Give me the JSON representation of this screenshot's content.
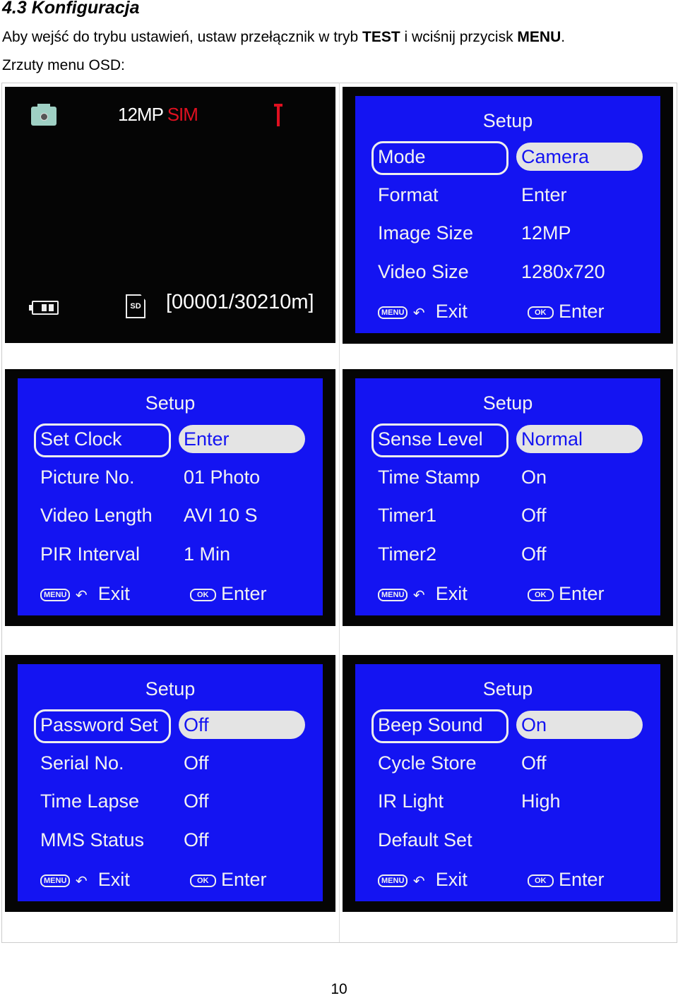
{
  "heading": "4.3 Konfiguracja",
  "intro": {
    "pre": "Aby wejść do trybu ustawień, ustaw przełącznik w tryb ",
    "b1": "TEST",
    "mid": " i wciśnij przycisk ",
    "b2": "MENU",
    "post": "."
  },
  "caption": "Zrzuty menu OSD:",
  "live_view": {
    "resolution": "12MP",
    "sim": "SIM",
    "counter": "[00001/30210m]",
    "sd_label": "SD",
    "icons": [
      "camera-icon",
      "antenna-icon",
      "battery-icon",
      "sd-card-icon"
    ],
    "sim_color": "#e01020"
  },
  "colors": {
    "osd_blue": "#1414f2"
  },
  "footer": {
    "menu_key": "MENU",
    "exit": "Exit",
    "ok_key": "OK",
    "enter": "Enter"
  },
  "screens": [
    {
      "title": "Setup",
      "rows": [
        {
          "label": "Mode",
          "value": "Camera"
        },
        {
          "label": "Format",
          "value": "Enter"
        },
        {
          "label": "Image Size",
          "value": "12MP"
        },
        {
          "label": "Video Size",
          "value": "1280x720"
        }
      ]
    },
    {
      "title": "Setup",
      "rows": [
        {
          "label": "Set Clock",
          "value": "Enter"
        },
        {
          "label": "Picture  No.",
          "value": "01 Photo"
        },
        {
          "label": "Video Length",
          "value": "AVI 10 S"
        },
        {
          "label": "PIR Interval",
          "value": "1 Min"
        }
      ]
    },
    {
      "title": "Setup",
      "rows": [
        {
          "label": "Sense Level",
          "value": "Normal"
        },
        {
          "label": "Time Stamp",
          "value": "On"
        },
        {
          "label": "Timer1",
          "value": "Off"
        },
        {
          "label": "Timer2",
          "value": "Off"
        }
      ]
    },
    {
      "title": "Setup",
      "rows": [
        {
          "label": "Password Set",
          "value": "Off"
        },
        {
          "label": "Serial No.",
          "value": "Off"
        },
        {
          "label": "Time Lapse",
          "value": "Off"
        },
        {
          "label": "MMS Status",
          "value": "Off"
        }
      ]
    },
    {
      "title": "Setup",
      "rows": [
        {
          "label": "Beep Sound",
          "value": "On"
        },
        {
          "label": "Cycle Store",
          "value": "Off"
        },
        {
          "label": "IR Light",
          "value": "High"
        },
        {
          "label": "Default Set",
          "value": ""
        }
      ]
    }
  ],
  "page_number": "10"
}
